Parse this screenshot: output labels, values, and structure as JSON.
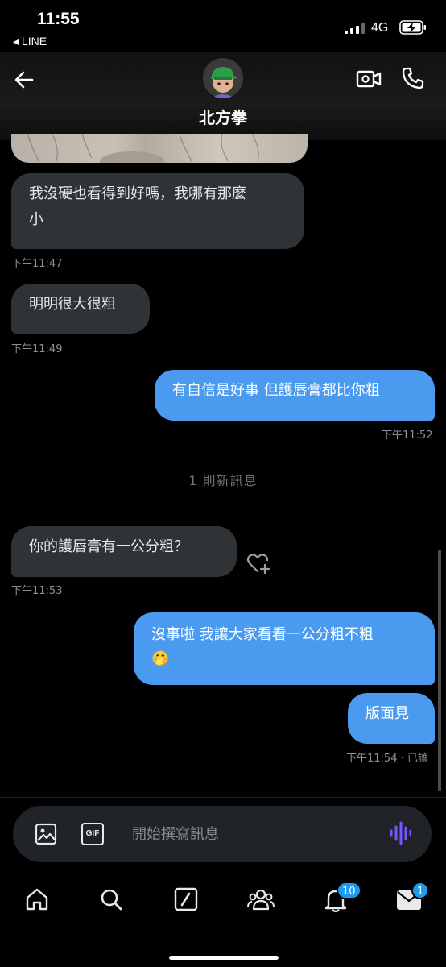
{
  "status_bar": {
    "time": "11:55",
    "back_app": "◂ LINE",
    "network": "4G"
  },
  "header": {
    "title": "北方拳"
  },
  "messages": [
    {
      "id": "m1",
      "side": "received",
      "text_line1": "我沒硬也看得到好嗎，我哪有那麼",
      "text_line2": "小",
      "time": "下午11:47"
    },
    {
      "id": "m2",
      "side": "received",
      "text": "明明很大很粗",
      "time": "下午11:49"
    },
    {
      "id": "m3",
      "side": "sent",
      "text": "有自信是好事 但護唇膏都比你粗",
      "time": "下午11:52"
    },
    {
      "id": "m4",
      "side": "received",
      "text": "你的護唇膏有一公分粗？",
      "time": "下午11:53"
    },
    {
      "id": "m5",
      "side": "sent",
      "text_line1": "沒事啦 我讓大家看看一公分粗不粗",
      "text_line2": "🤭"
    },
    {
      "id": "m6",
      "side": "sent",
      "text": "版面見",
      "time": "下午11:54 · 已讀"
    }
  ],
  "divider": {
    "text": "1 則新訊息"
  },
  "composer": {
    "placeholder": "開始撰寫訊息",
    "gif_label": "GIF"
  },
  "tabbar": {
    "notifications_badge": "10",
    "messages_badge": "1"
  },
  "colors": {
    "accent": "#1d9bf0",
    "received_bubble": "#2f3336",
    "sent_bubble": "#4a9bf0",
    "voice": "#7856ff"
  }
}
